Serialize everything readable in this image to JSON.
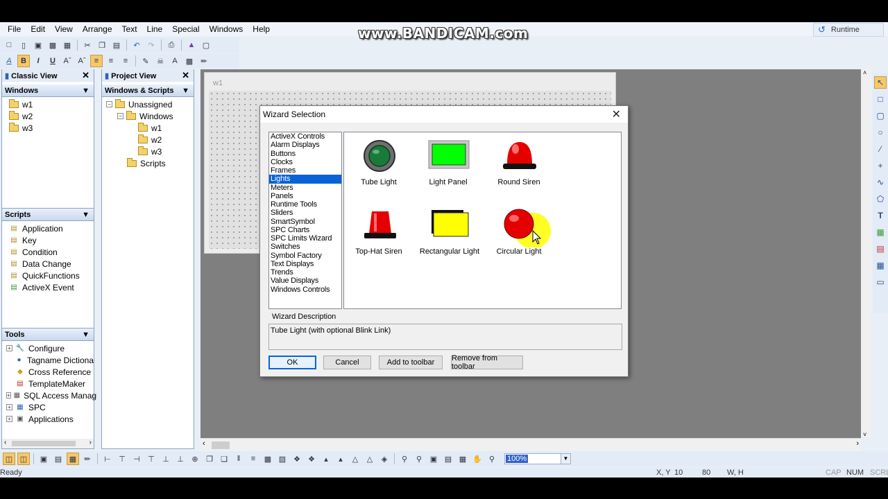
{
  "menubar": {
    "items": [
      "File",
      "Edit",
      "View",
      "Arrange",
      "Text",
      "Line",
      "Special",
      "Windows",
      "Help"
    ],
    "runtime_label": "Runtime"
  },
  "watermark": "www.BANDICAM.com",
  "classic_view": {
    "title": "Classic View",
    "windows_header": "Windows",
    "windows": [
      "w1",
      "w2",
      "w3"
    ],
    "scripts_header": "Scripts",
    "scripts": [
      "Application",
      "Key",
      "Condition",
      "Data Change",
      "QuickFunctions",
      "ActiveX Event"
    ],
    "tools_header": "Tools",
    "tools": [
      "Configure",
      "Tagname Dictiona",
      "Cross Reference",
      "TemplateMaker",
      "SQL Access Manag",
      "SPC",
      "Applications"
    ]
  },
  "project_view": {
    "title": "Project View",
    "header": "Windows & Scripts",
    "unassigned": "Unassigned",
    "windows_folder": "Windows",
    "windows": [
      "w1",
      "w2",
      "w3"
    ],
    "scripts_folder": "Scripts"
  },
  "canvas": {
    "window_title": "w1"
  },
  "dialog": {
    "title": "Wizard Selection",
    "categories": [
      "ActiveX Controls",
      "Alarm Displays",
      "Buttons",
      "Clocks",
      "Frames",
      "Lights",
      "Meters",
      "Panels",
      "Runtime Tools",
      "Sliders",
      "SmartSymbol",
      "SPC Charts",
      "SPC Limits Wizard",
      "Switches",
      "Symbol Factory",
      "Text Displays",
      "Trends",
      "Value Displays",
      "Windows Controls"
    ],
    "selected_category": "Lights",
    "wizards": {
      "tube_light": "Tube Light",
      "light_panel": "Light Panel",
      "round_siren": "Round Siren",
      "top_hat_siren": "Top-Hat Siren",
      "rectangular_light": "Rectangular Light",
      "circular_light": "Circular Light"
    },
    "description_label": "Wizard Description",
    "description_text": "Tube Light (with optional Blink Link)",
    "buttons": {
      "ok": "OK",
      "cancel": "Cancel",
      "add_to_toolbar": "Add to toolbar",
      "remove_from_toolbar": "Remove from  toolbar"
    }
  },
  "bottom_toolbar": {
    "zoom": "100%"
  },
  "statusbar": {
    "ready": "Ready",
    "xy_label": "X, Y",
    "x": "10",
    "y": "80",
    "wh_label": "W, H",
    "cap": "CAP",
    "num": "NUM",
    "scrl": "SCRL"
  },
  "colors": {
    "selection": "#0a62d8",
    "tube_light_green": "#1a7a3a",
    "light_panel_green": "#00ff00",
    "siren_red": "#e40000",
    "rect_light_yellow": "#ffff00"
  }
}
